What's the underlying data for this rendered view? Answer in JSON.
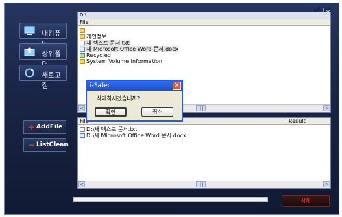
{
  "window": {
    "minimize_label": "_",
    "close_label": "x"
  },
  "sidebar": {
    "top_buttons": [
      {
        "label": "내컴퓨터",
        "icon": "monitor-icon"
      },
      {
        "label": "상위폴더",
        "icon": "folder-up-icon"
      },
      {
        "label": "새로고침",
        "icon": "refresh-icon"
      }
    ],
    "add_file": {
      "label": "AddFile",
      "icon": "plus-icon"
    },
    "list_clean": {
      "label": "ListClean",
      "icon": "minus-icon"
    }
  },
  "browser": {
    "path": "D:\\",
    "column": "File",
    "items": [
      {
        "name": "..",
        "icon": "folder-icon"
      },
      {
        "name": "개인정보",
        "icon": "folder-icon"
      },
      {
        "name": "새 텍스트 문서.txt",
        "icon": "text-file-icon"
      },
      {
        "name": "새 Microsoft Office Word 문서.docx",
        "icon": "word-file-icon"
      },
      {
        "name": "Recycled",
        "icon": "recycle-icon"
      },
      {
        "name": "System Volume Information",
        "icon": "folder-icon"
      }
    ]
  },
  "queue": {
    "columns": [
      "File",
      "Result"
    ],
    "items": [
      {
        "name": "D:\\새 텍스트 문서.txt",
        "icon": "text-file-icon"
      },
      {
        "name": "D:\\새 Microsoft Office Word 문서.docx",
        "icon": "word-file-icon"
      }
    ]
  },
  "scroll": {
    "left": "<",
    "right": ">",
    "mid": "|||"
  },
  "delete_button": {
    "label": "삭제"
  },
  "dialog": {
    "title": "i-Safer",
    "message": "삭제하시겠습니까?",
    "ok": "확인",
    "cancel": "취소",
    "close": "X"
  }
}
